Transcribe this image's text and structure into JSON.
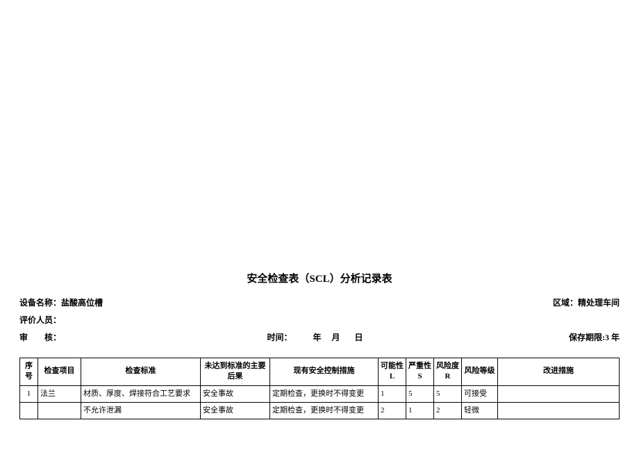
{
  "title": "安全检查表（SCL）分析记录表",
  "labels": {
    "device_name_label": "设备名称：",
    "device_name_value": "盐酸高位槽",
    "area_label": "区域：",
    "area_value": "精处理车间",
    "evaluator_label": "评价人员：",
    "reviewer_label": "审　　核：",
    "time_label": "时间：",
    "time_year": "年",
    "time_month": "月",
    "time_day": "日",
    "retention_label": "保存期限:",
    "retention_value": "3 年"
  },
  "headers": {
    "seq": "序号",
    "item": "检查项目",
    "standard": "检查标准",
    "consequence": "未达到标准的主要后果",
    "measure": "现有安全控制措施",
    "l": "可能性 L",
    "s": "严重性 S",
    "r": "风险度 R",
    "level": "风险等级",
    "improve": "改进措施"
  },
  "rows": [
    {
      "seq": "1",
      "item": "法兰",
      "standard": "材质、厚度、焊接符合工艺要求",
      "consequence": "安全事故",
      "measure": "定期检查，更换时不得变更",
      "l": "1",
      "s": "5",
      "r": "5",
      "level": "可接受",
      "improve": ""
    },
    {
      "seq": "",
      "item": "",
      "standard": "不允许泄漏",
      "consequence": "安全事故",
      "measure": "定期检查，更换时不得变更",
      "l": "2",
      "s": "1",
      "r": "2",
      "level": "轻微",
      "improve": ""
    }
  ]
}
